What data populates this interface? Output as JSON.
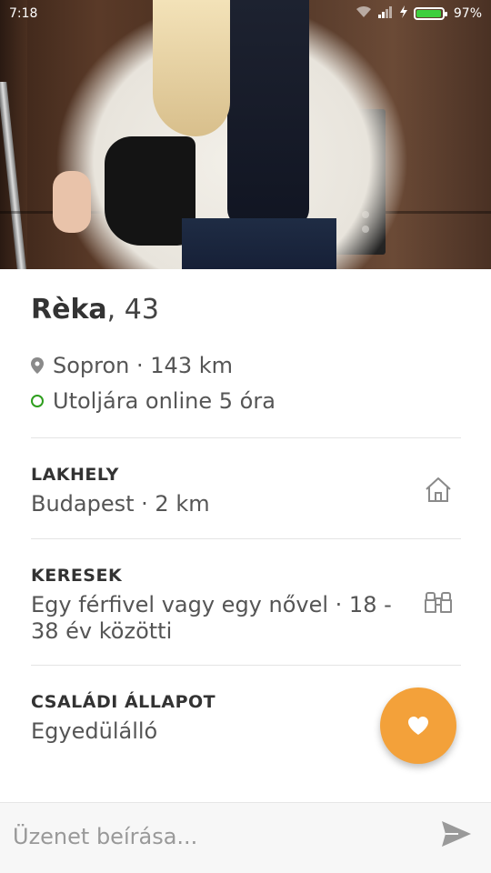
{
  "status_bar": {
    "time": "7:18",
    "battery_level": "97%",
    "battery_fill": 0.97
  },
  "profile": {
    "name": "Rèka",
    "age_suffix": ", 43",
    "location": "Sopron · 143 km",
    "online_status": "Utoljára online 5 óra"
  },
  "sections": [
    {
      "title": "LAKHELY",
      "value": "Budapest · 2 km",
      "icon": "house-icon"
    },
    {
      "title": "KERESEK",
      "value_line1": "Egy férfivel vagy egy nővel · 18 -",
      "value_line2": "38 év közötti",
      "icon": "binoculars-icon"
    },
    {
      "title": "CSALÁDI ÁLLAPOT",
      "value": "Egyedülálló"
    }
  ],
  "fab": {
    "icon": "heart-icon",
    "color": "#f3a13a"
  },
  "message_bar": {
    "placeholder": "Üzenet beírása...",
    "send_icon": "send-icon"
  },
  "colors": {
    "online": "#2e9e1e",
    "accent": "#f3a13a",
    "battery": "#3ecf3e"
  }
}
